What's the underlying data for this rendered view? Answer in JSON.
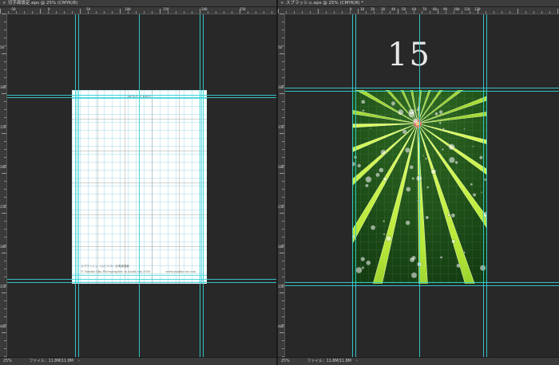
{
  "left_window": {
    "tab_title": "切手面設定.eps @ 25% (CMYK/8)",
    "ruler_top": [
      "-50",
      "0",
      "50",
      "100",
      "150",
      "200",
      "250",
      "300"
    ],
    "ruler_left": [
      "50",
      "100",
      "150",
      "200",
      "250",
      "300",
      "350",
      "400"
    ],
    "postcard": {
      "title": "POST CARD",
      "caption": "スプラッシュ（ルピナス）北海道撮影",
      "copyright": "© Yumiko Oka Photographer, in Asahi city 2016",
      "url": "www.yumiko-on.com"
    },
    "status": {
      "zoom": "25%",
      "file_info": "ファイル：11.8M/11.8M",
      "arrow": "›"
    }
  },
  "right_window": {
    "tab_title": "スプラッシュ.eps @ 25% (CMYK/8) *",
    "ruler_top": [
      "0",
      "10",
      "20",
      "30",
      "40",
      "50",
      "60",
      "70",
      "80",
      "90",
      "100",
      "110",
      "120"
    ],
    "ruler_left": [
      "50",
      "100",
      "150",
      "200",
      "250",
      "300",
      "350",
      "400"
    ],
    "page_number": "15",
    "status": {
      "zoom": "25%",
      "file_info": "ファイル：11.8M/11.8M",
      "arrow": "›"
    }
  },
  "colors": {
    "guide": "#35d0d6",
    "canvas": "#282828",
    "leaf_light": "#c8f03a",
    "leaf_dark": "#1f5a1a",
    "center_pink": "#e36b7a"
  },
  "icons": {
    "tab_close": "×"
  }
}
